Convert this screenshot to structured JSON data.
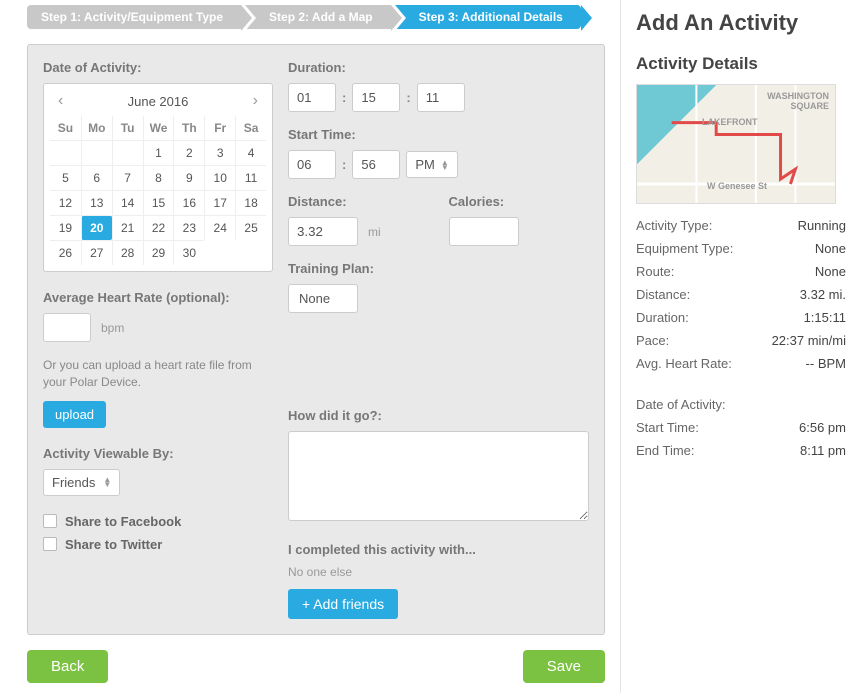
{
  "steps": [
    {
      "label": "Step 1: Activity/Equipment Type",
      "active": false
    },
    {
      "label": "Step 2: Add a Map",
      "active": false
    },
    {
      "label": "Step 3: Additional Details",
      "active": true
    }
  ],
  "date": {
    "label": "Date of Activity:",
    "month_title": "June 2016",
    "dow": [
      "Su",
      "Mo",
      "Tu",
      "We",
      "Th",
      "Fr",
      "Sa"
    ],
    "leading_empty": 3,
    "days": 30,
    "selected": 20
  },
  "duration": {
    "label": "Duration:",
    "h": "01",
    "m": "15",
    "s": "11"
  },
  "start_time": {
    "label": "Start Time:",
    "h": "06",
    "m": "56",
    "ampm": "PM"
  },
  "distance": {
    "label": "Distance:",
    "value": "3.32",
    "unit": "mi"
  },
  "calories": {
    "label": "Calories:",
    "value": ""
  },
  "training_plan": {
    "label": "Training Plan:",
    "value": "None"
  },
  "heart_rate": {
    "label": "Average Heart Rate (optional):",
    "unit": "bpm",
    "hint": "Or you can upload a heart rate file from your Polar Device.",
    "upload_label": "upload"
  },
  "visibility": {
    "label": "Activity Viewable By:",
    "value": "Friends"
  },
  "share": {
    "facebook": "Share to Facebook",
    "twitter": "Share to Twitter"
  },
  "notes": {
    "label": "How did it go?:"
  },
  "companions": {
    "label": "I completed this activity with...",
    "none": "No one else",
    "add_label": "+ Add friends"
  },
  "buttons": {
    "back": "Back",
    "save": "Save"
  },
  "sidebar": {
    "title": "Add An Activity",
    "subtitle": "Activity Details",
    "map_labels": {
      "lakefront": "LAKEFRONT",
      "washington": "WASHINGTON SQUARE",
      "genesee": "W Genesee St"
    },
    "rows1": [
      {
        "k": "Activity Type:",
        "v": "Running"
      },
      {
        "k": "Equipment Type:",
        "v": "None"
      },
      {
        "k": "Route:",
        "v": "None"
      },
      {
        "k": "Distance:",
        "v": "3.32 mi."
      },
      {
        "k": "Duration:",
        "v": "1:15:11"
      },
      {
        "k": "Pace:",
        "v": "22:37 min/mi"
      },
      {
        "k": "Avg. Heart Rate:",
        "v": "-- BPM"
      }
    ],
    "rows2": [
      {
        "k": "Date of Activity:",
        "v": ""
      },
      {
        "k": "Start Time:",
        "v": "6:56 pm"
      },
      {
        "k": "End Time:",
        "v": "8:11 pm"
      }
    ]
  }
}
